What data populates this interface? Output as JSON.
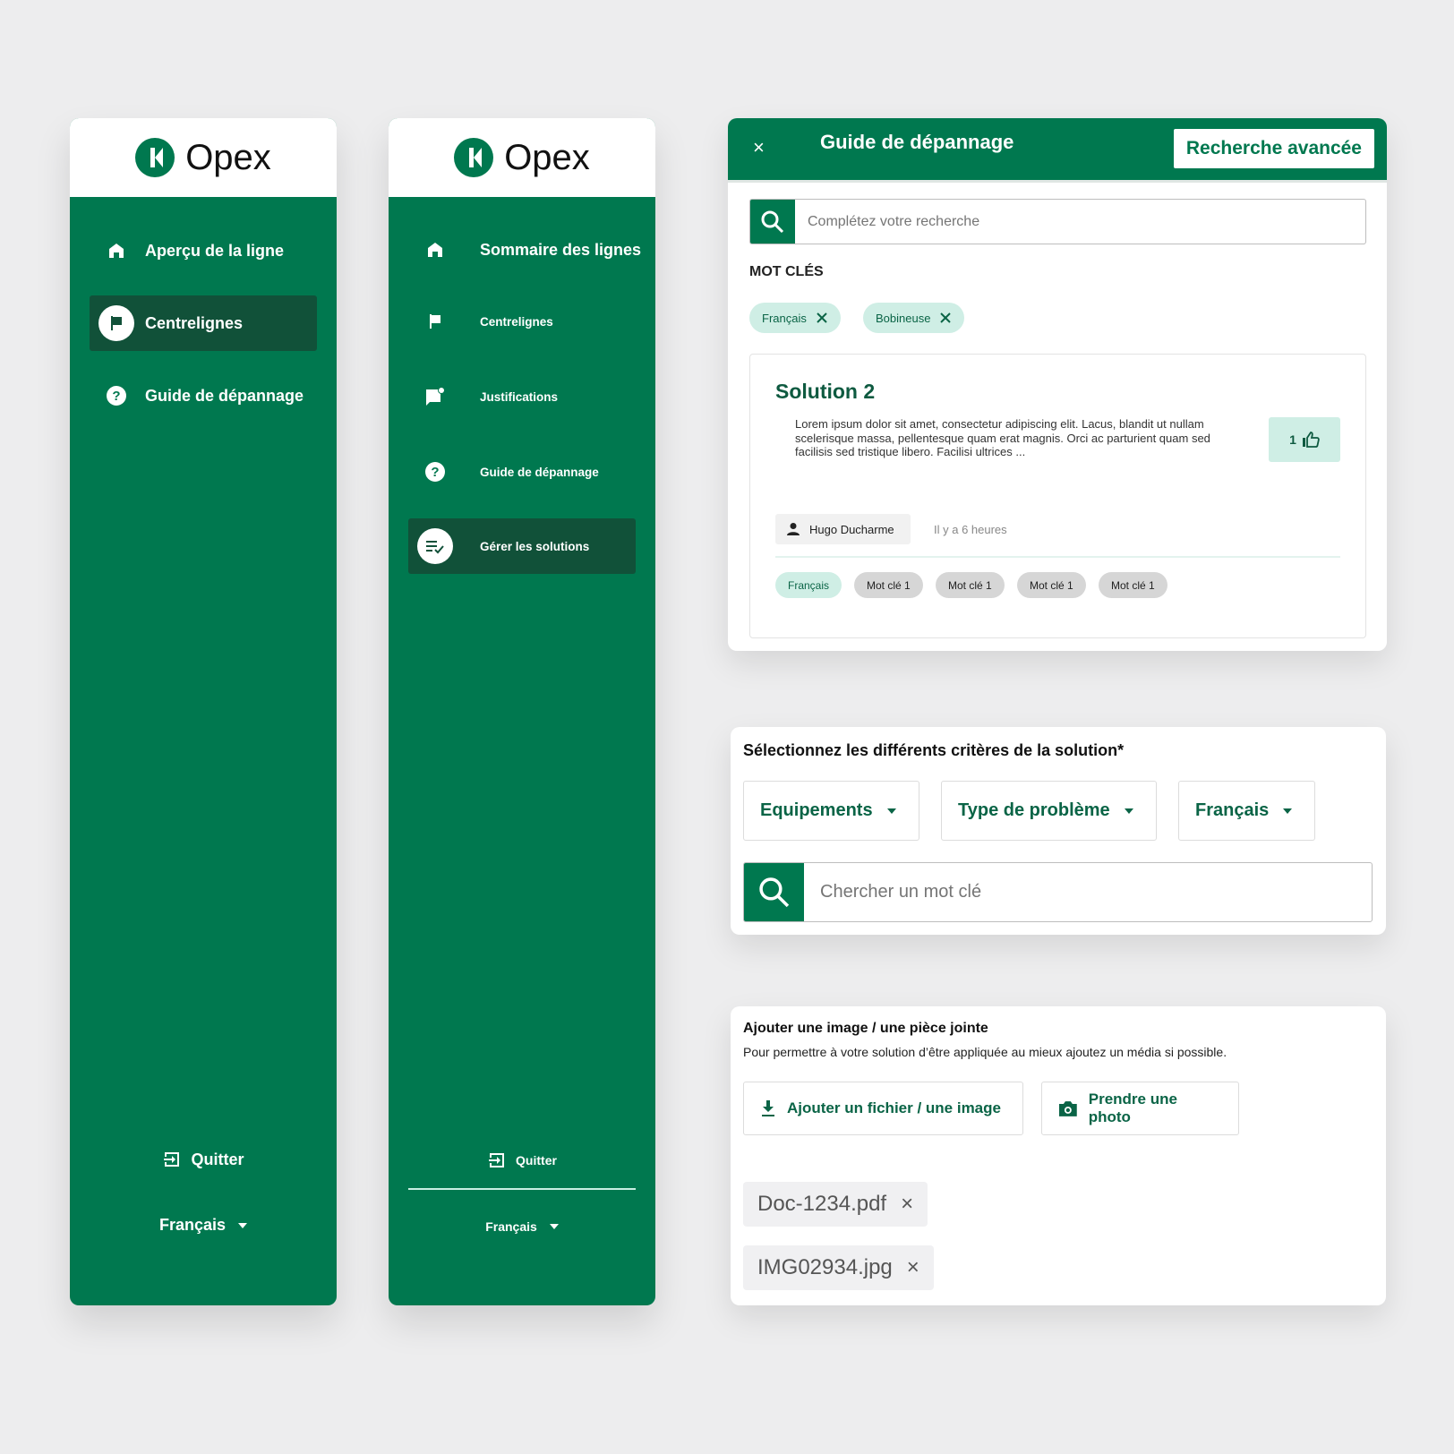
{
  "brand": {
    "name": "Opex",
    "color": "#00784f",
    "dark": "#115139",
    "mint": "#cfeee5"
  },
  "sidebar1": {
    "items": [
      {
        "label": "Aperçu de la ligne",
        "icon": "home-icon",
        "active": false
      },
      {
        "label": "Centrelignes",
        "icon": "flag-icon",
        "active": true
      },
      {
        "label": "Guide de dépannage",
        "icon": "help-icon",
        "active": false
      }
    ],
    "quit_label": "Quitter",
    "language": "Français"
  },
  "sidebar2": {
    "items": [
      {
        "label": "Sommaire des lignes",
        "icon": "home-icon",
        "active": false
      },
      {
        "label": "Centrelignes",
        "icon": "flag-icon",
        "active": false
      },
      {
        "label": "Justifications",
        "icon": "chat-notification-icon",
        "active": false
      },
      {
        "label": "Guide de dépannage",
        "icon": "help-icon",
        "active": false
      },
      {
        "label": "Gérer les solutions",
        "icon": "list-check-icon",
        "active": true
      }
    ],
    "quit_label": "Quitter",
    "language": "Français"
  },
  "guide": {
    "close": "×",
    "title": "Guide de dépannage",
    "advanced_search": "Recherche avancée",
    "search_placeholder": "Complétez votre recherche",
    "keywords_title": "MOT CLÉS",
    "keyword_chips": [
      "Français",
      "Bobineuse"
    ],
    "solution": {
      "title": "Solution 2",
      "text": "Lorem ipsum dolor sit amet, consectetur adipiscing elit. Lacus, blandit ut nullam scelerisque massa, pellentesque quam erat magnis. Orci ac parturient quam sed facilisis sed tristique libero. Facilisi ultrices ...",
      "likes": "1",
      "author": "Hugo Ducharme",
      "time": "Il y a 6 heures",
      "tags": [
        "Français",
        "Mot clé 1",
        "Mot clé 1",
        "Mot clé 1",
        "Mot clé 1"
      ]
    }
  },
  "criteria": {
    "title": "Sélectionnez les différents critères de la solution*",
    "dropdowns": [
      "Equipements",
      "Type de problème",
      "Français"
    ],
    "search_placeholder": "Chercher un mot clé"
  },
  "attach": {
    "title": "Ajouter une image / une pièce jointe",
    "subtitle": "Pour permettre à votre solution d’être appliquée au mieux ajoutez un média si possible.",
    "add_file_label": "Ajouter un fichier / une image",
    "take_photo_label": "Prendre une photo",
    "files": [
      "Doc-1234.pdf",
      "IMG02934.jpg"
    ],
    "remove": "×"
  }
}
